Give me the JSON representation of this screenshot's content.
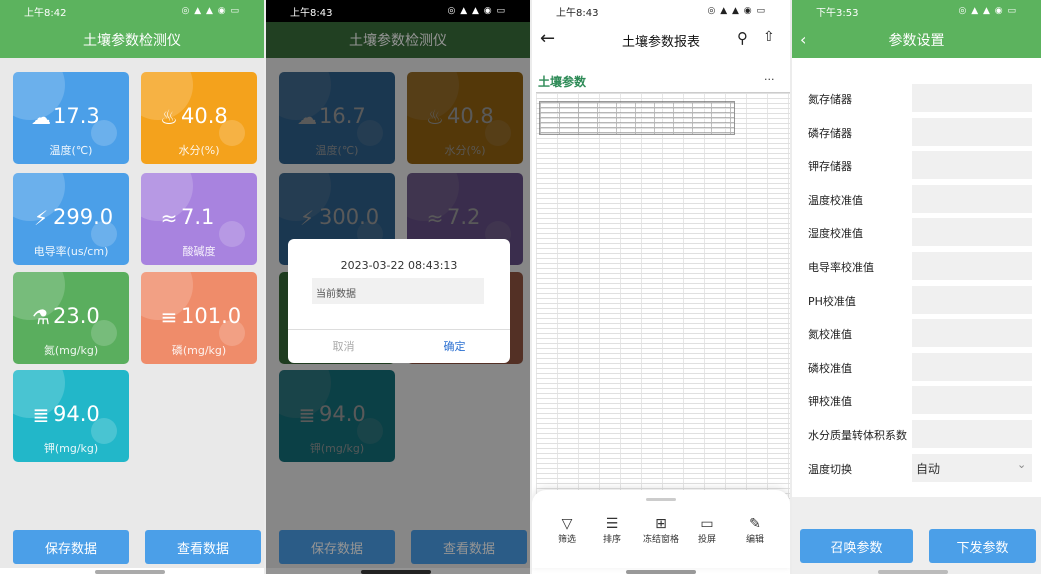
{
  "panel1": {
    "status_time": "上午8:42",
    "title": "土壤参数检测仪",
    "tiles": [
      {
        "value": "17.3",
        "label": "温度(℃)",
        "color": "#4b9fe8"
      },
      {
        "value": "40.8",
        "label": "水分(%)",
        "color": "#f4a21c"
      },
      {
        "value": "299.0",
        "label": "电导率(us/cm)",
        "color": "#4b9fe8"
      },
      {
        "value": "7.1",
        "label": "酸碱度",
        "color": "#a883df"
      },
      {
        "value": "23.0",
        "label": "氮(mg/kg)",
        "color": "#5aae5e"
      },
      {
        "value": "101.0",
        "label": "磷(mg/kg)",
        "color": "#ef8c6a"
      },
      {
        "value": "94.0",
        "label": "钾(mg/kg)",
        "color": "#22b7c9"
      }
    ],
    "save_button": "保存数据",
    "view_button": "查看数据"
  },
  "panel2": {
    "status_time": "上午8:43",
    "title": "土壤参数检测仪",
    "tiles": [
      {
        "value": "16.7",
        "label": "温度(℃)"
      },
      {
        "value": "40.8",
        "label": "水分(%)"
      },
      {
        "value": "300.0",
        "label": ""
      },
      {
        "value": "7.2",
        "label": ""
      },
      {
        "value": "94.0",
        "label": "钾(mg/kg)"
      }
    ],
    "dialog": {
      "datetime": "2023-03-22 08:43:13",
      "field_text": "当前数据",
      "cancel": "取消",
      "confirm": "确定"
    },
    "save_button": "保存数据",
    "view_button": "查看数据"
  },
  "panel3": {
    "status_time": "上午8:43",
    "title": "土壤参数报表",
    "sheet_title": "土壤参数",
    "more": "···",
    "toolbar": [
      "筛选",
      "排序",
      "冻结窗格",
      "投屏",
      "编辑"
    ]
  },
  "panel4": {
    "status_time": "下午3:53",
    "title": "参数设置",
    "rows": [
      {
        "label": "氮存储器",
        "value": ""
      },
      {
        "label": "磷存储器",
        "value": ""
      },
      {
        "label": "钾存储器",
        "value": ""
      },
      {
        "label": "温度校准值",
        "value": ""
      },
      {
        "label": "湿度校准值",
        "value": ""
      },
      {
        "label": "电导率校准值",
        "value": ""
      },
      {
        "label": "PH校准值",
        "value": ""
      },
      {
        "label": "氮校准值",
        "value": ""
      },
      {
        "label": "磷校准值",
        "value": ""
      },
      {
        "label": "钾校准值",
        "value": ""
      },
      {
        "label": "水分质量转体积系数",
        "value": ""
      },
      {
        "label": "温度切换",
        "value": "自动"
      }
    ],
    "recall_button": "召唤参数",
    "send_button": "下发参数"
  }
}
